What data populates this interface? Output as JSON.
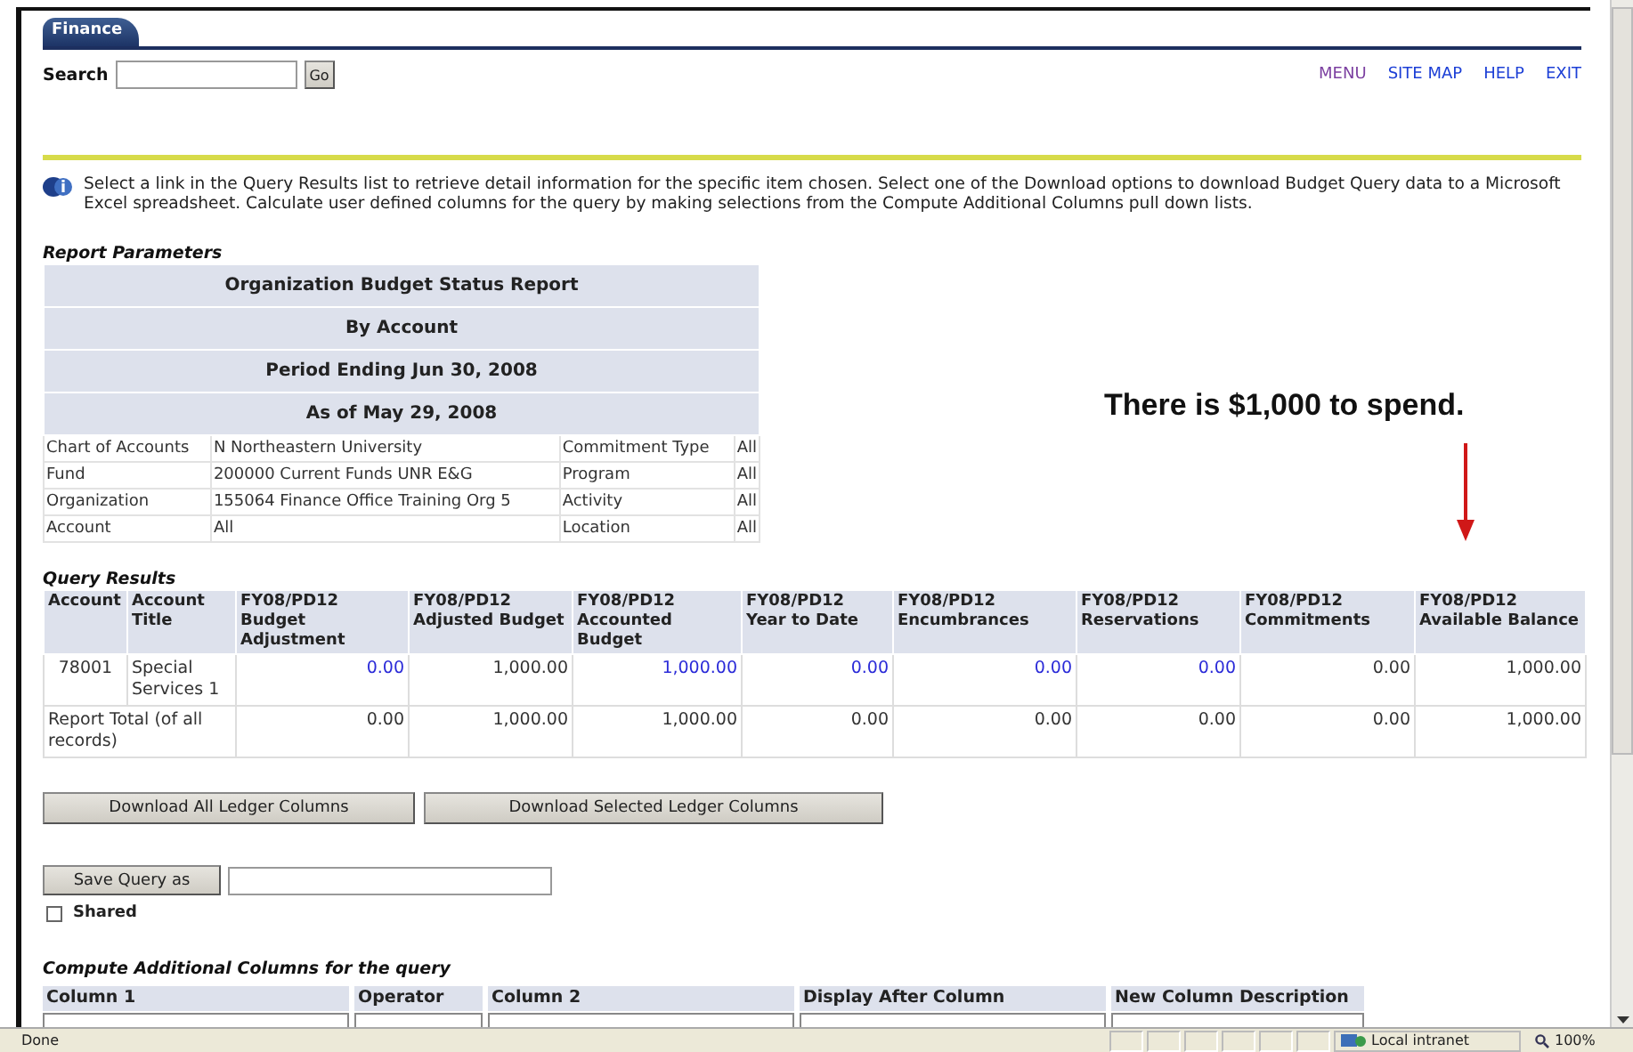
{
  "tab": {
    "label": "Finance",
    "selected": true
  },
  "search": {
    "label": "Search",
    "button": "Go"
  },
  "nav_links": [
    {
      "label": "MENU",
      "visited": true
    },
    {
      "label": "SITE MAP",
      "visited": false
    },
    {
      "label": "HELP",
      "visited": false
    },
    {
      "label": "EXIT",
      "visited": false
    }
  ],
  "info_text": "Select a link in the Query Results list to retrieve detail information for the specific item chosen. Select one of the Download options to download Budget Query data to a Microsoft Excel spreadsheet. Calculate user defined columns for the query by making selections from the Compute Additional Columns pull down lists.",
  "report_parameters": {
    "title": "Report Parameters",
    "headings": [
      "Organization Budget Status Report",
      "By Account",
      "Period Ending Jun 30, 2008",
      "As of May 29, 2008"
    ],
    "rows": [
      [
        "Chart of Accounts",
        "N Northeastern University",
        "Commitment Type",
        "All"
      ],
      [
        "Fund",
        "200000 Current Funds UNR E&G",
        "Program",
        "All"
      ],
      [
        "Organization",
        "155064 Finance Office Training Org 5",
        "Activity",
        "All"
      ],
      [
        "Account",
        "All",
        "Location",
        "All"
      ]
    ]
  },
  "annotation": {
    "text": "There is $1,000 to spend."
  },
  "query_results": {
    "title": "Query Results",
    "columns": [
      "Account",
      "Account Title",
      "FY08/PD12 Budget Adjustment",
      "FY08/PD12 Adjusted Budget",
      "FY08/PD12 Accounted Budget",
      "FY08/PD12 Year to Date",
      "FY08/PD12 Encumbrances",
      "FY08/PD12 Reservations",
      "FY08/PD12 Commitments",
      "FY08/PD12 Available Balance"
    ],
    "rows": [
      {
        "kind": "detail",
        "cells": [
          {
            "text": "78001",
            "linked": false
          },
          {
            "text": "Special Services 1",
            "linked": false
          },
          {
            "text": "0.00",
            "linked": true
          },
          {
            "text": "1,000.00",
            "linked": false
          },
          {
            "text": "1,000.00",
            "linked": true
          },
          {
            "text": "0.00",
            "linked": true
          },
          {
            "text": "0.00",
            "linked": true
          },
          {
            "text": "0.00",
            "linked": true
          },
          {
            "text": "0.00",
            "linked": false
          },
          {
            "text": "1,000.00",
            "linked": false
          }
        ]
      },
      {
        "kind": "total",
        "cells": [
          {
            "text": "Report Total (of all records)",
            "linked": false,
            "colspan": 2
          },
          {
            "text": "0.00",
            "linked": false
          },
          {
            "text": "1,000.00",
            "linked": false
          },
          {
            "text": "1,000.00",
            "linked": false
          },
          {
            "text": "0.00",
            "linked": false
          },
          {
            "text": "0.00",
            "linked": false
          },
          {
            "text": "0.00",
            "linked": false
          },
          {
            "text": "0.00",
            "linked": false
          },
          {
            "text": "1,000.00",
            "linked": false
          }
        ]
      }
    ]
  },
  "downloads": [
    "Download All Ledger Columns",
    "Download Selected Ledger Columns"
  ],
  "save_query": {
    "button": "Save Query as"
  },
  "shared": {
    "label": "Shared",
    "checked": false
  },
  "compute": {
    "title": "Compute Additional Columns for the query",
    "columns": [
      "Column 1",
      "Operator",
      "Column 2",
      "Display After Column",
      "New Column Description"
    ]
  },
  "status_bar": {
    "text": "Done",
    "zone": "Local intranet",
    "zoom": "100%"
  }
}
